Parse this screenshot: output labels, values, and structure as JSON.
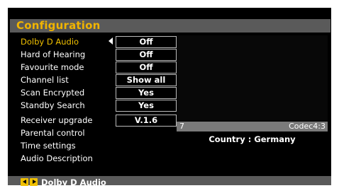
{
  "menu": {
    "title": "Configuration",
    "items": [
      {
        "label": "Dolby D Audio",
        "value": "Off",
        "selected": true
      },
      {
        "label": "Hard of Hearing",
        "value": "Off"
      },
      {
        "label": "Favourite mode",
        "value": "Off"
      },
      {
        "label": "Channel list",
        "value": "Show all"
      },
      {
        "label": "Scan Encrypted",
        "value": "Yes"
      },
      {
        "label": "Standby Search",
        "value": "Yes"
      },
      {
        "label": "Receiver upgrade",
        "value": "V.1.6"
      },
      {
        "label": "Parental control"
      },
      {
        "label": "Time settings"
      },
      {
        "label": "Audio Description"
      }
    ]
  },
  "preview": {
    "channel_number": "7",
    "codec_aspect": "Codec4:3",
    "country": "Country : Germany"
  },
  "footer": {
    "hint": "Dolby D Audio",
    "hint_icon": "left-right-keys-icon"
  },
  "colors": {
    "accent": "#f0c000",
    "background": "#000000",
    "bar": "#5a5a5a"
  }
}
